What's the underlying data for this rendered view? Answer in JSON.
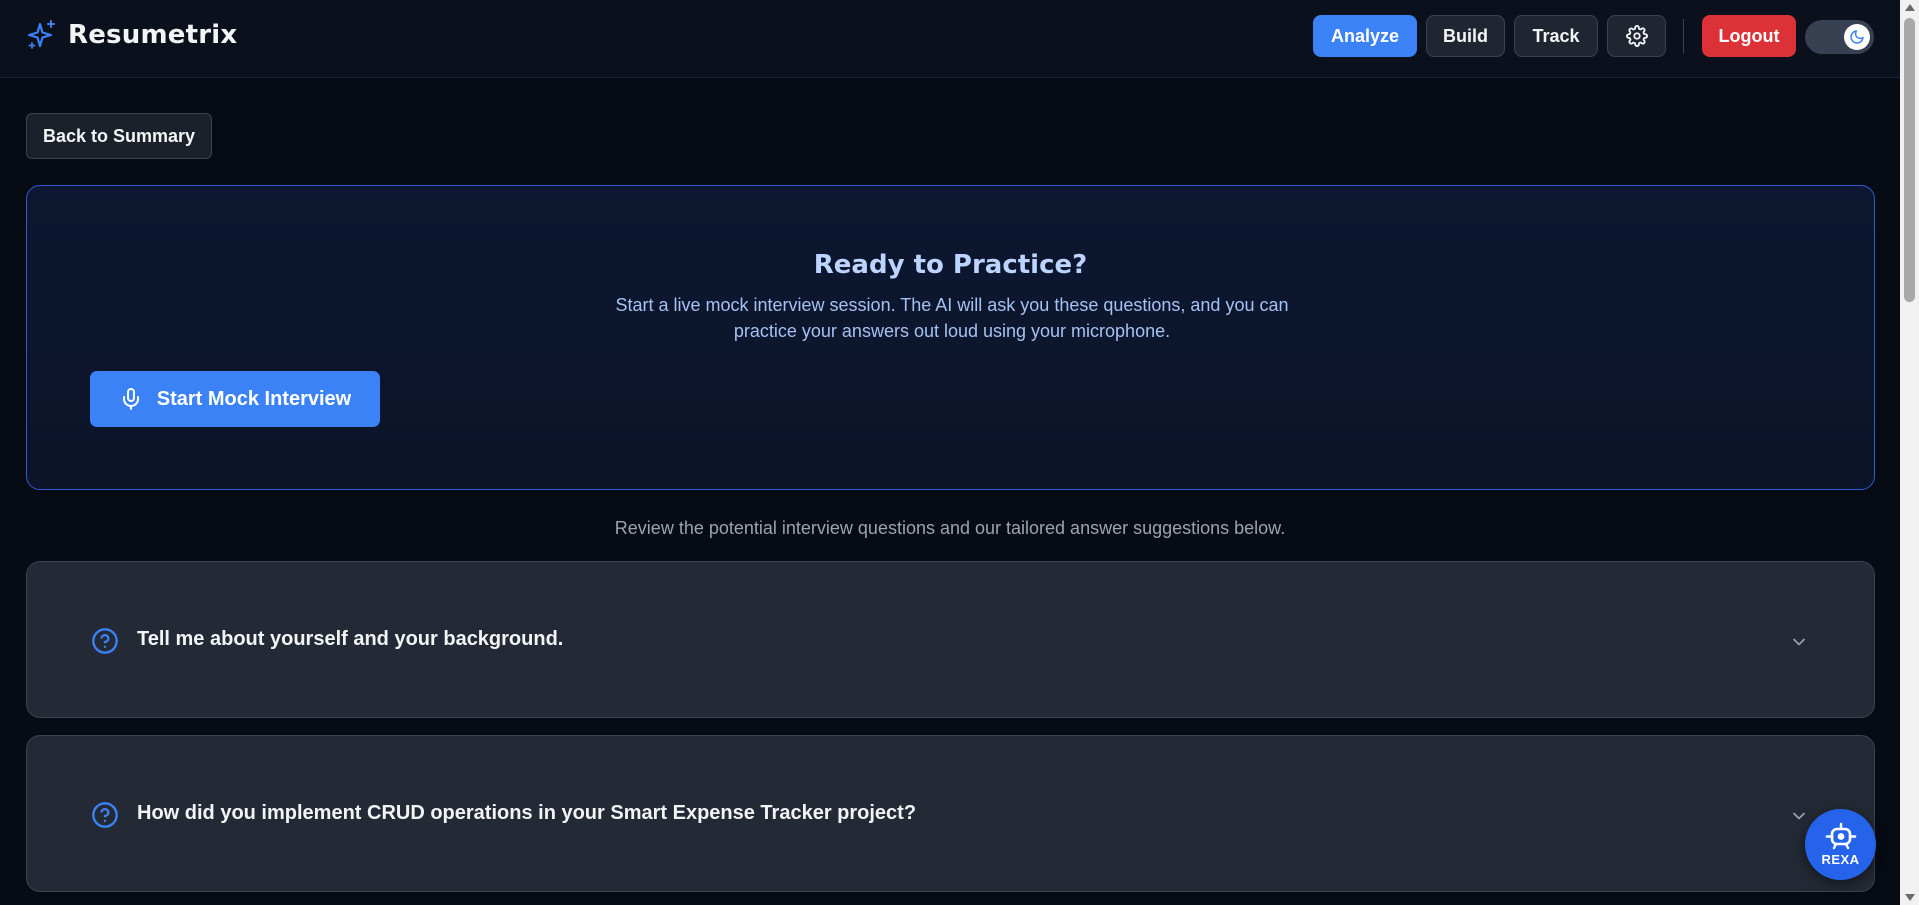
{
  "header": {
    "app_name": "Resumetrix",
    "nav": {
      "analyze": "Analyze",
      "build": "Build",
      "track": "Track",
      "logout": "Logout"
    },
    "theme_mode": "dark"
  },
  "back_button": "Back to Summary",
  "practice": {
    "title": "Ready to Practice?",
    "description": "Start a live mock interview session. The AI will ask you these questions, and you can practice your answers out loud using your microphone.",
    "start_button": "Start Mock Interview"
  },
  "review_text": "Review the potential interview questions and our tailored answer suggestions below.",
  "questions": [
    {
      "text": "Tell me about yourself and your background."
    },
    {
      "text": "How did you implement CRUD operations in your Smart Expense Tracker project?"
    }
  ],
  "assistant": {
    "label": "REXA"
  },
  "colors": {
    "accent": "#3b82f6",
    "logout": "#dc3237",
    "background": "#060b14",
    "card": "#242a35"
  }
}
